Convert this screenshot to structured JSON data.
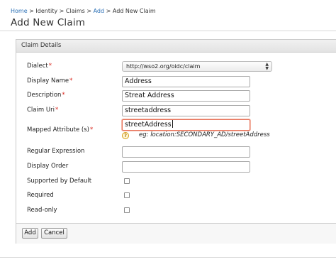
{
  "breadcrumb": {
    "home": "Home",
    "identity": "Identity",
    "claims": "Claims",
    "add": "Add",
    "current": "Add New Claim",
    "separator": ">"
  },
  "page": {
    "title": "Add New Claim"
  },
  "panel": {
    "header": "Claim Details"
  },
  "form": {
    "dialect": {
      "label": "Dialect",
      "value": "http://wso2.org/oidc/claim"
    },
    "display_name": {
      "label": "Display Name",
      "value": "Address"
    },
    "description": {
      "label": "Description",
      "value": "Streat Address"
    },
    "claim_uri": {
      "label": "Claim Uri",
      "value": "streetaddress"
    },
    "mapped_attribute": {
      "label": "Mapped Attribute (s)",
      "value": "streetAddress",
      "hint": "eg: location:SECONDARY_AD/streetAddress"
    },
    "regular_expression": {
      "label": "Regular Expression",
      "value": ""
    },
    "display_order": {
      "label": "Display Order",
      "value": ""
    },
    "supported_by_default": {
      "label": "Supported by Default",
      "checked": false
    },
    "required": {
      "label": "Required",
      "checked": false
    },
    "read_only": {
      "label": "Read-only",
      "checked": false
    },
    "required_marker": "*"
  },
  "buttons": {
    "add": "Add",
    "cancel": "Cancel"
  },
  "colors": {
    "link": "#2a6fb5",
    "required": "#d9261c",
    "active_border": "#e8735a"
  }
}
